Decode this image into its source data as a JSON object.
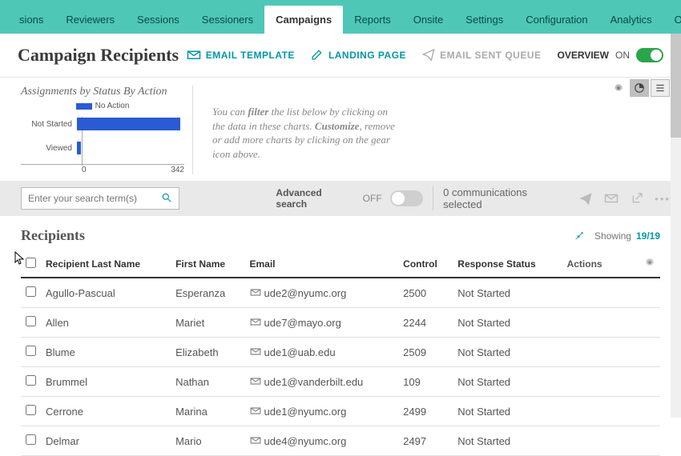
{
  "nav": {
    "tabs": [
      "sions",
      "Reviewers",
      "Sessions",
      "Sessioners",
      "Campaigns",
      "Reports",
      "Onsite",
      "Settings",
      "Configuration",
      "Analytics",
      "Operation"
    ],
    "active_index": 4
  },
  "header": {
    "title": "Campaign Recipients",
    "links": {
      "email_template": "EMAIL TEMPLATE",
      "landing_page": "LANDING PAGE",
      "email_sent_queue": "EMAIL SENT QUEUE"
    },
    "overview_label": "OVERVIEW",
    "overview_on": "ON"
  },
  "chart": {
    "title": "Assignments by Status By Action",
    "legend": "No Action",
    "axis": {
      "min": "0",
      "max": "342"
    },
    "help_text_parts": {
      "a": "You can ",
      "filter": "filter",
      "b": " the list below by clicking on the data in these charts. ",
      "customize": "Customize",
      "c": ", remove or add more charts by clicking on the gear icon above."
    }
  },
  "chart_data": {
    "type": "bar",
    "orientation": "horizontal",
    "categories": [
      "Not Started",
      "Viewed"
    ],
    "series": [
      {
        "name": "No Action",
        "values": [
          330,
          12
        ]
      }
    ],
    "xlim": [
      0,
      342
    ],
    "title": "Assignments by Status By Action",
    "xlabel": "",
    "ylabel": ""
  },
  "search": {
    "placeholder": "Enter your search term(s)",
    "advanced_label": "Advanced search",
    "advanced_state": "OFF",
    "selected_text": "0 communications selected"
  },
  "table": {
    "title": "Recipients",
    "showing_prefix": "Showing",
    "showing_count": "19/19",
    "columns": {
      "last": "Recipient Last Name",
      "first": "First Name",
      "email": "Email",
      "control": "Control",
      "response": "Response Status",
      "actions": "Actions"
    },
    "rows": [
      {
        "last": "Agullo-Pascual",
        "first": "Esperanza",
        "email": "ude2@nyumc.org",
        "control": "2500",
        "response": "Not Started"
      },
      {
        "last": "Allen",
        "first": "Mariet",
        "email": "ude7@mayo.org",
        "control": "2244",
        "response": "Not Started"
      },
      {
        "last": "Blume",
        "first": "Elizabeth",
        "email": "ude1@uab.edu",
        "control": "2509",
        "response": "Not Started"
      },
      {
        "last": "Brummel",
        "first": "Nathan",
        "email": "ude1@vanderbilt.edu",
        "control": "109",
        "response": "Not Started"
      },
      {
        "last": "Cerrone",
        "first": "Marina",
        "email": "ude1@nyumc.org",
        "control": "2499",
        "response": "Not Started"
      },
      {
        "last": "Delmar",
        "first": "Mario",
        "email": "ude4@nyumc.org",
        "control": "2497",
        "response": "Not Started"
      }
    ]
  }
}
